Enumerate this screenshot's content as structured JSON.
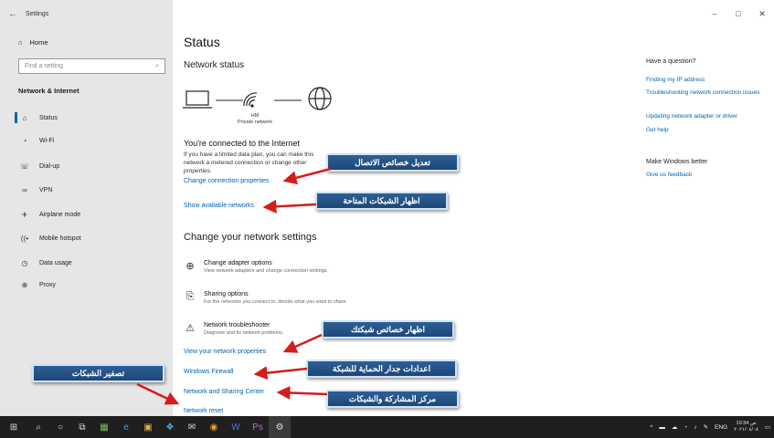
{
  "window": {
    "title": "Settings",
    "back": "←",
    "controls": [
      "–",
      "□",
      "✕"
    ]
  },
  "sidebar": {
    "home": "Home",
    "search_placeholder": "Find a setting",
    "section": "Network & Internet",
    "items": [
      {
        "label": "Status",
        "icon": "⌂"
      },
      {
        "label": "Wi-Fi",
        "icon": "◔"
      },
      {
        "label": "Dial-up",
        "icon": "☏"
      },
      {
        "label": "VPN",
        "icon": "∞"
      },
      {
        "label": "Airplane mode",
        "icon": "✈"
      },
      {
        "label": "Mobile hotspot",
        "icon": "((•"
      },
      {
        "label": "Data usage",
        "icon": "◷"
      },
      {
        "label": "Proxy",
        "icon": "⊕"
      }
    ]
  },
  "main": {
    "title": "Status",
    "network_status": "Network status",
    "network_name": "HM",
    "network_type": "Private network",
    "connected": "You're connected to the Internet",
    "connected_desc": "If you have a limited data plan, you can make this network a metered connection or change other properties.",
    "change_props": "Change connection properties",
    "show_networks": "Show available networks",
    "change_settings": "Change your network settings",
    "options": [
      {
        "title": "Change adapter options",
        "desc": "View network adapters and change connection settings.",
        "icon": "⊕"
      },
      {
        "title": "Sharing options",
        "desc": "For the networks you connect to, decide what you want to share.",
        "icon": "⎘"
      },
      {
        "title": "Network troubleshooter",
        "desc": "Diagnose and fix network problems.",
        "icon": "⚠"
      }
    ],
    "view_props": "View your network properties",
    "firewall": "Windows Firewall",
    "sharing_center": "Network and Sharing Center",
    "reset": "Network reset"
  },
  "right_panel": {
    "question_title": "Have a question?",
    "links": [
      "Finding my IP address",
      "Troubleshooting network connection issues",
      "Updating network adapter or driver",
      "Get help"
    ],
    "better_title": "Make Windows better",
    "feedback": "Give us feedback"
  },
  "callouts": {
    "c1": "تعديل خصائص الاتصال",
    "c2": "اظهار الشبكات المتاحة",
    "c3": "اظهار خصائص شبكتك",
    "c4": "اعدادات جدار الحماية للشبكة",
    "c5": "مركز المشاركة والشبكات",
    "c6": "تصفير الشبكات"
  },
  "taskbar": {
    "lang": "ENG",
    "time": "10:34 ص",
    "date": "٢٠٢١/٠٤/٠٨"
  }
}
